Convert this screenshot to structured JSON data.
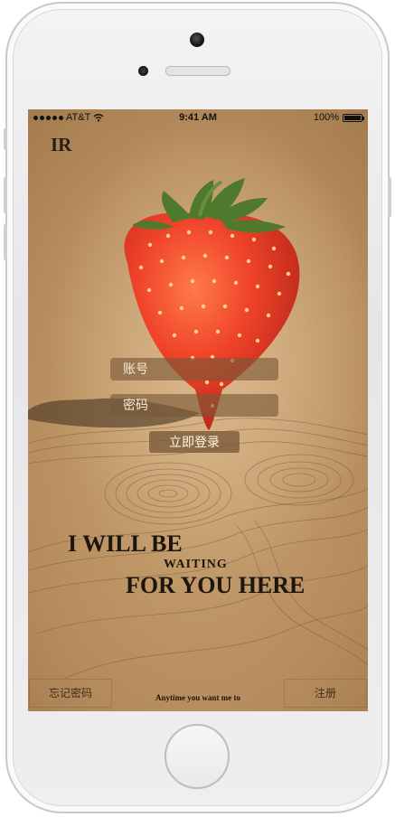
{
  "status_bar": {
    "carrier": "AT&T",
    "time": "9:41 AM",
    "battery": "100%"
  },
  "app": {
    "logo": "IR"
  },
  "form": {
    "account_placeholder": "账号",
    "password_placeholder": "密码",
    "login_label": "立即登录"
  },
  "slogan": {
    "line1": "I WILL BE",
    "line2": "WAITING",
    "line3": "FOR YOU HERE",
    "tagline": "Anytime you want me to"
  },
  "links": {
    "forgot_password": "忘记密码",
    "register": "注册"
  },
  "icons": [
    "signal-dots-icon",
    "wifi-icon",
    "battery-icon"
  ],
  "colors": {
    "background": "#c9a373",
    "field": "#785837",
    "text_dark": "#1e150d"
  }
}
